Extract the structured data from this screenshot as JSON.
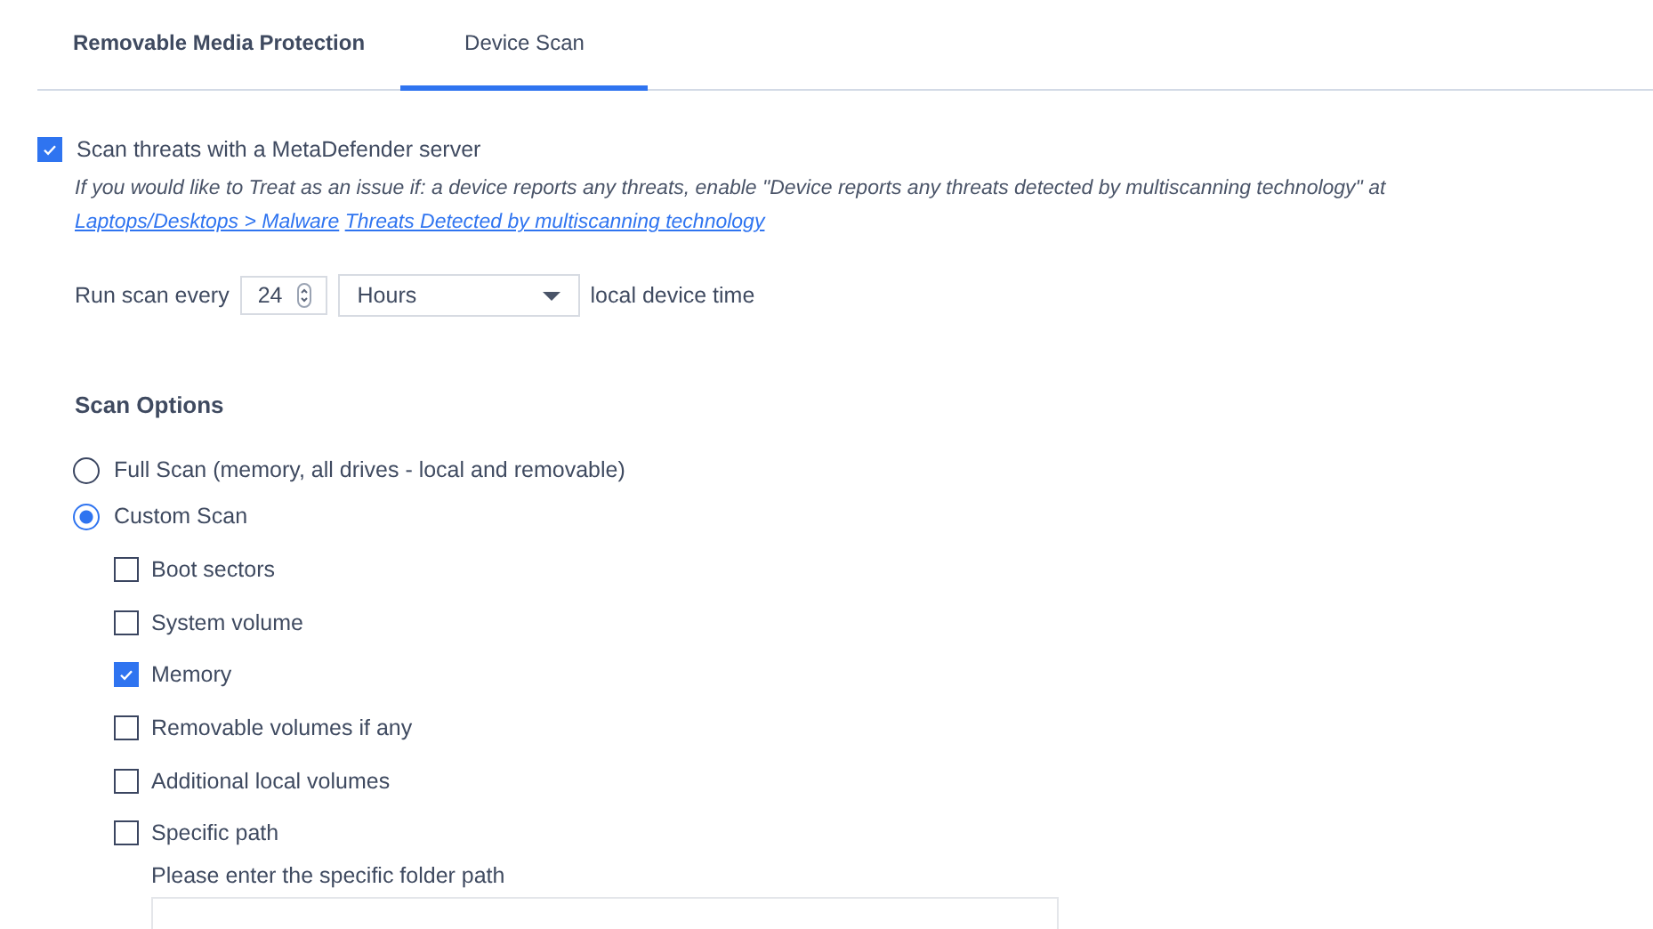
{
  "tabs": [
    {
      "label": "Removable Media Protection",
      "selected": false
    },
    {
      "label": "Device Scan",
      "selected": true
    }
  ],
  "server_option": {
    "label": "Scan threats with a MetaDefender server",
    "checked": true
  },
  "help": {
    "text": "If you would like to Treat as an issue if: a device reports any threats, enable \"Device reports any threats detected by multiscanning technology\" at",
    "links": [
      "Laptops/Desktops > Malware",
      "Threats Detected by multiscanning technology"
    ]
  },
  "schedule": {
    "label": "Run scan every",
    "interval": "24",
    "unit": "Hours",
    "suffix": "local device time"
  },
  "scan_options": {
    "title": "Scan Options",
    "radios": [
      {
        "label": "Full Scan (memory, all drives - local and removable)",
        "selected": false
      },
      {
        "label": "Custom Scan",
        "selected": true
      }
    ],
    "checkboxes": [
      {
        "label": "Boot sectors",
        "checked": false
      },
      {
        "label": "System volume",
        "checked": false
      },
      {
        "label": "Memory",
        "checked": true
      },
      {
        "label": "Removable volumes if any",
        "checked": false
      },
      {
        "label": "Additional local volumes",
        "checked": false
      },
      {
        "label": "Specific path",
        "checked": false
      }
    ],
    "path_label": "Please enter the specific folder path"
  }
}
